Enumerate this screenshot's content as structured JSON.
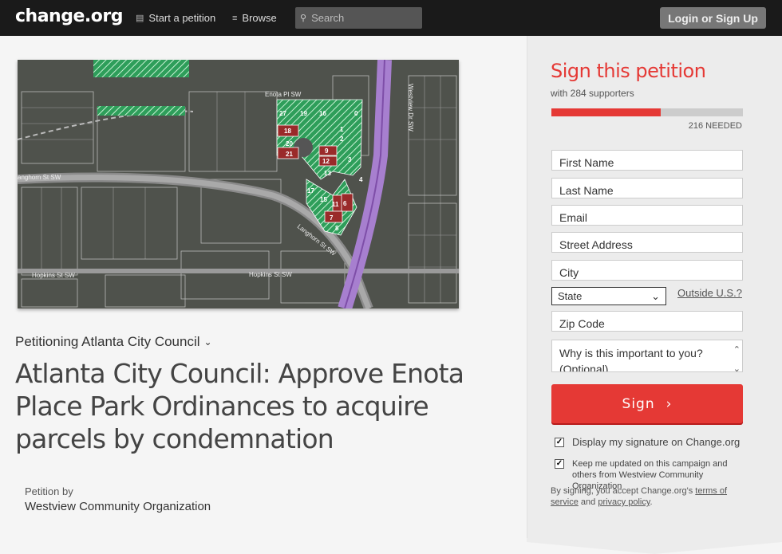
{
  "header": {
    "logo": "change.org",
    "nav": [
      {
        "label": "Start a petition",
        "icon": "document-icon"
      },
      {
        "label": "Browse",
        "icon": "list-icon"
      }
    ],
    "search_placeholder": "Search",
    "login_label": "Login or Sign Up"
  },
  "petition": {
    "petitioning": "Petitioning Atlanta City Council",
    "title": "Atlanta City Council: Approve Enota Place Park Ordinances to acquire parcels by condemnation",
    "petition_by_label": "Petition by",
    "petition_by_name": "Westview Community Organization",
    "map": {
      "street_labels": [
        "Enota Pl SW",
        "Langhorn St SW",
        "Hopkins St SW",
        "Hopkins St SW",
        "Westview Dr SW",
        "Langhorn St SW"
      ],
      "parcels": [
        "27",
        "19",
        "16",
        "0",
        "18",
        "1",
        "2",
        "20",
        "21",
        "9",
        "12",
        "3",
        "13",
        "4",
        "17",
        "15",
        "11",
        "6",
        "7",
        "8"
      ]
    }
  },
  "sign_panel": {
    "title": "Sign this petition",
    "supporters": "with 284 supporters",
    "progress_fraction": 0.57,
    "needed": "216 NEEDED",
    "fields": {
      "first_name": "First Name",
      "last_name": "Last Name",
      "email": "Email",
      "street": "Street Address",
      "city": "City",
      "zip": "Zip Code"
    },
    "state_selected": "State",
    "outside_us": "Outside U.S.?",
    "why_placeholder": "Why is this important to you? (Optional)",
    "sign_label": "Sign",
    "check_display": "Display my signature on Change.org",
    "check_updates": "Keep me updated on this campaign and others from Westview Community Organization",
    "terms_prefix": "By signing, you accept Change.org's",
    "terms_link": "terms of service",
    "terms_and": "and",
    "privacy_link": "privacy policy",
    "terms_suffix": "."
  },
  "colors": {
    "brand_red": "#e53935",
    "header_bg": "#1a1a1a"
  }
}
